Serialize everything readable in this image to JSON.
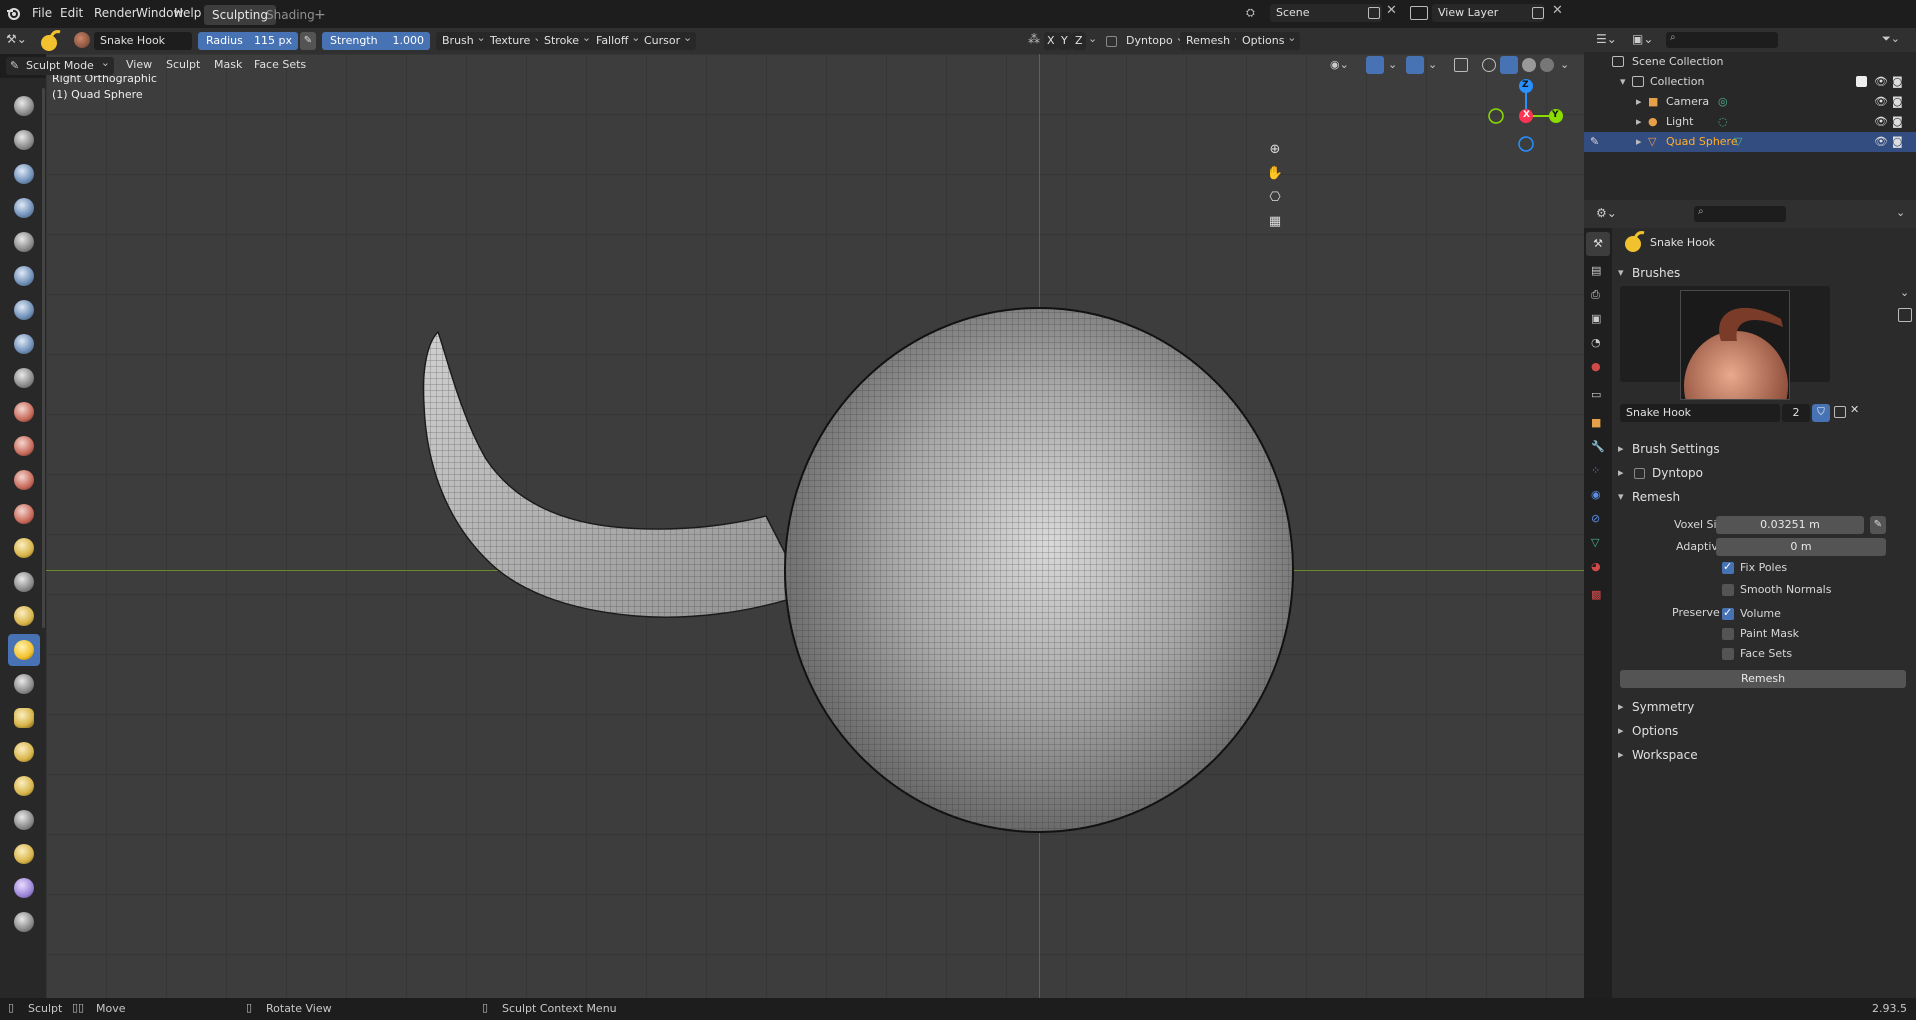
{
  "menu": [
    "File",
    "Edit",
    "Render",
    "Window",
    "Help"
  ],
  "workspaces": {
    "active": "Sculpting",
    "inactive": "Shading",
    "add": "+"
  },
  "scene": {
    "name": "Scene",
    "view_layer": "View Layer"
  },
  "tool_header": {
    "brush_name": "Snake Hook",
    "radius_label": "Radius",
    "radius_value": "115 px",
    "strength_label": "Strength",
    "strength_value": "1.000",
    "dropdowns": [
      "Brush",
      "Texture",
      "Stroke",
      "Falloff",
      "Cursor"
    ],
    "axes": [
      "X",
      "Y",
      "Z"
    ],
    "dyntopo": "Dyntopo",
    "remesh": "Remesh",
    "options": "Options"
  },
  "view_header": {
    "mode": "Sculpt Mode",
    "menus": [
      "View",
      "Sculpt",
      "Mask",
      "Face Sets"
    ]
  },
  "viewport": {
    "view_name": "Right Orthographic",
    "object_name": "(1) Quad Sphere",
    "gizmo": {
      "z": "Z",
      "x": "X",
      "y": "Y"
    }
  },
  "outliner": {
    "root": "Scene Collection",
    "collection": "Collection",
    "items": [
      "Camera",
      "Light",
      "Quad Sphere"
    ],
    "selected": "Quad Sphere"
  },
  "properties": {
    "tool_name": "Snake Hook",
    "brushes_header": "Brushes",
    "brush_field": "Snake Hook",
    "brush_users": "2",
    "sections": [
      "Brush Settings",
      "Dyntopo",
      "Remesh"
    ],
    "remesh": {
      "voxel_size_label": "Voxel Size",
      "voxel_size_value": "0.03251 m",
      "adaptivity_label": "Adaptivity",
      "adaptivity_value": "0 m",
      "fix_poles": "Fix Poles",
      "smooth_normals": "Smooth Normals",
      "preserve_label": "Preserve",
      "volume": "Volume",
      "paint_mask": "Paint Mask",
      "face_sets": "Face Sets",
      "button": "Remesh"
    },
    "collapsed_sections": [
      "Symmetry",
      "Options",
      "Workspace"
    ]
  },
  "statusbar": {
    "items": [
      "Sculpt",
      "Move",
      "Rotate View",
      "Sculpt Context Menu"
    ],
    "version": "2.93.5"
  },
  "colors": {
    "accent": "#4772b3",
    "selected_text": "#ffaf29",
    "x_axis": "#ff3352",
    "y_axis": "#8bdc00",
    "z_axis": "#2890ff"
  }
}
